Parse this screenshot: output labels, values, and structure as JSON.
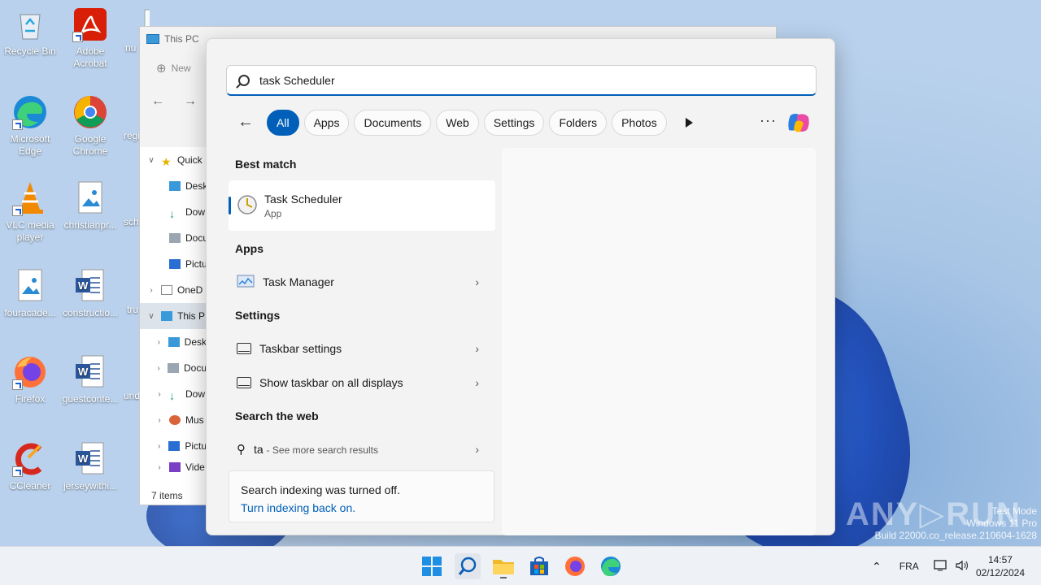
{
  "desktop": {
    "icons": [
      "Recycle Bin",
      "Adobe\nAcrobat",
      "nu",
      "Microsoft\nEdge",
      "Google\nChrome",
      "regi",
      "VLC media\nplayer",
      "christianpr...",
      "sch",
      "fouracade...",
      "constructio...",
      "tru",
      "Firefox",
      "guestconte...",
      "und",
      "CCleaner",
      "jerseywithi..."
    ]
  },
  "explorer": {
    "title": "This PC",
    "new_label": "New",
    "tree": [
      "Quick",
      "Desk",
      "Dow",
      "Docu",
      "Pictu",
      "OneD",
      "This P",
      "Desk",
      "Docu",
      "Dow",
      "Mus",
      "Pictu",
      "Vide"
    ],
    "status": "7 items"
  },
  "search": {
    "query": "task Scheduler",
    "filters": [
      "All",
      "Apps",
      "Documents",
      "Web",
      "Settings",
      "Folders",
      "Photos"
    ],
    "more_label": "···",
    "best_match_title": "Best match",
    "best_match": {
      "name": "Task Scheduler",
      "type": "App"
    },
    "apps_title": "Apps",
    "apps": [
      "Task Manager"
    ],
    "settings_title": "Settings",
    "settings": [
      "Taskbar settings",
      "Show taskbar on all displays"
    ],
    "web_title": "Search the web",
    "web_query": "ta",
    "web_more": "- See more search results",
    "indexing_text": "Search indexing was turned off.",
    "indexing_link": "Turn indexing back on."
  },
  "taskbar": {
    "lang": "FRA",
    "time": "14:57",
    "date": "02/12/2024"
  },
  "watermark": {
    "mode": "Test Mode",
    "edition": "Windows 11 Pro",
    "build": "Build 22000.co_release.210604-1628",
    "brand": "ANY▷RUN"
  },
  "colors": {
    "accent": "#005fb8",
    "panel": "#f3f3f3"
  }
}
